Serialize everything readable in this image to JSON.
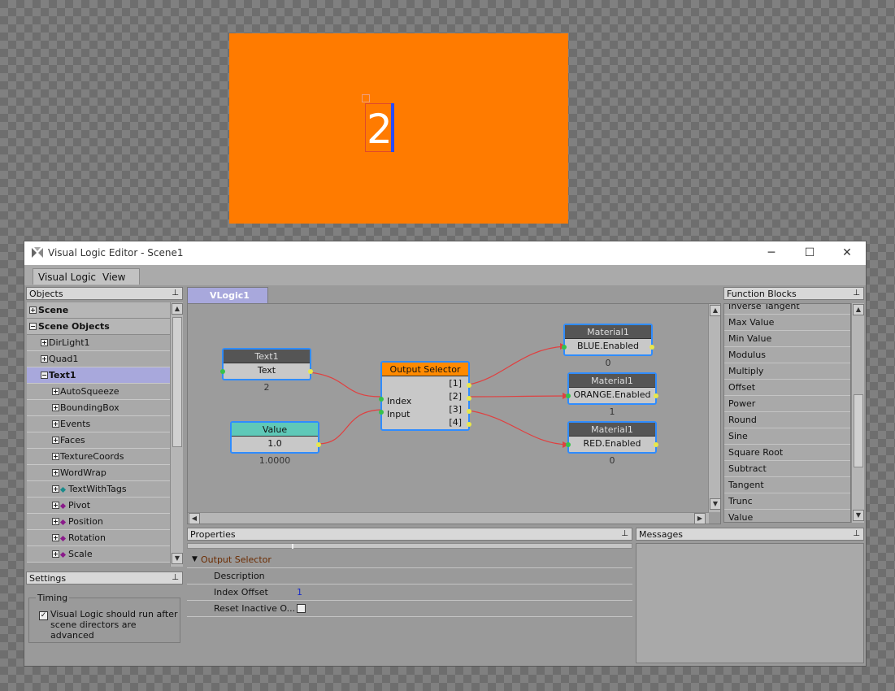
{
  "preview": {
    "text": "2",
    "background_color": "#ff7b00"
  },
  "window": {
    "title": "Visual Logic Editor - Scene1",
    "controls": {
      "minimize": "─",
      "maximize": "☐",
      "close": "✕"
    }
  },
  "menu": {
    "items": [
      "Visual Logic",
      "View"
    ]
  },
  "objects_panel": {
    "title": "Objects",
    "pin": "⊥",
    "rows": [
      {
        "label": "Scene",
        "toggle": "+"
      },
      {
        "label": "Scene Objects",
        "toggle": "−"
      },
      {
        "label": "DirLight1",
        "toggle": "+"
      },
      {
        "label": "Quad1",
        "toggle": "+"
      },
      {
        "label": "Text1",
        "toggle": "−"
      },
      {
        "label": "AutoSqueeze",
        "toggle": "+"
      },
      {
        "label": "BoundingBox",
        "toggle": "+"
      },
      {
        "label": "Events",
        "toggle": "+"
      },
      {
        "label": "Faces",
        "toggle": "+"
      },
      {
        "label": "TextureCoords",
        "toggle": "+"
      },
      {
        "label": "WordWrap",
        "toggle": "+"
      },
      {
        "label": "TextWithTags",
        "toggle": "+",
        "marker_color": "#1a8a8a"
      },
      {
        "label": "Pivot",
        "toggle": "+",
        "marker_color": "#8a1a8a"
      },
      {
        "label": "Position",
        "toggle": "+",
        "marker_color": "#8a1a8a"
      },
      {
        "label": "Rotation",
        "toggle": "+",
        "marker_color": "#8a1a8a"
      },
      {
        "label": "Scale",
        "toggle": "+",
        "marker_color": "#8a1a8a"
      }
    ]
  },
  "settings_panel": {
    "title": "Settings",
    "pin": "⊥",
    "group_label": "Timing",
    "checkbox_label_line1": "Visual Logic should run after",
    "checkbox_label_line2": "scene directors are advanced",
    "checkbox_mark": "✓",
    "checked": true
  },
  "graph": {
    "tab_label": "VLogic1",
    "nodes": {
      "text1": {
        "header": "Text1",
        "field": "Text",
        "value": "2"
      },
      "value": {
        "header": "Value",
        "field": "1.0",
        "value": "1.0000"
      },
      "selector": {
        "header": "Output Selector",
        "inputs": [
          "Index",
          "Input"
        ],
        "outputs": [
          "[1]",
          "[2]",
          "[3]",
          "[4]"
        ]
      },
      "mat_blue": {
        "header": "Material1",
        "field": "BLUE.Enabled",
        "value": "0"
      },
      "mat_orange": {
        "header": "Material1",
        "field": "ORANGE.Enabled",
        "value": "1"
      },
      "mat_red": {
        "header": "Material1",
        "field": "RED.Enabled",
        "value": "0"
      }
    },
    "colors": {
      "wire": "#e04040",
      "node_border": "#2f8cff",
      "selector_header": "#ff8a00",
      "value_header": "#5fc8b8"
    }
  },
  "properties_panel": {
    "title": "Properties",
    "pin": "⊥",
    "group": "Output Selector",
    "rows": [
      {
        "label": "Description",
        "value": ""
      },
      {
        "label": "Index Offset",
        "value": "1"
      },
      {
        "label": "Reset Inactive O...",
        "value": ""
      }
    ]
  },
  "function_blocks_panel": {
    "title": "Function Blocks",
    "pin": "⊥",
    "items": [
      "Inverse Tangent",
      "Max Value",
      "Min Value",
      "Modulus",
      "Multiply",
      "Offset",
      "Power",
      "Round",
      "Sine",
      "Square Root",
      "Subtract",
      "Tangent",
      "Trunc",
      "Value"
    ]
  },
  "messages_panel": {
    "title": "Messages",
    "pin": "⊥"
  }
}
